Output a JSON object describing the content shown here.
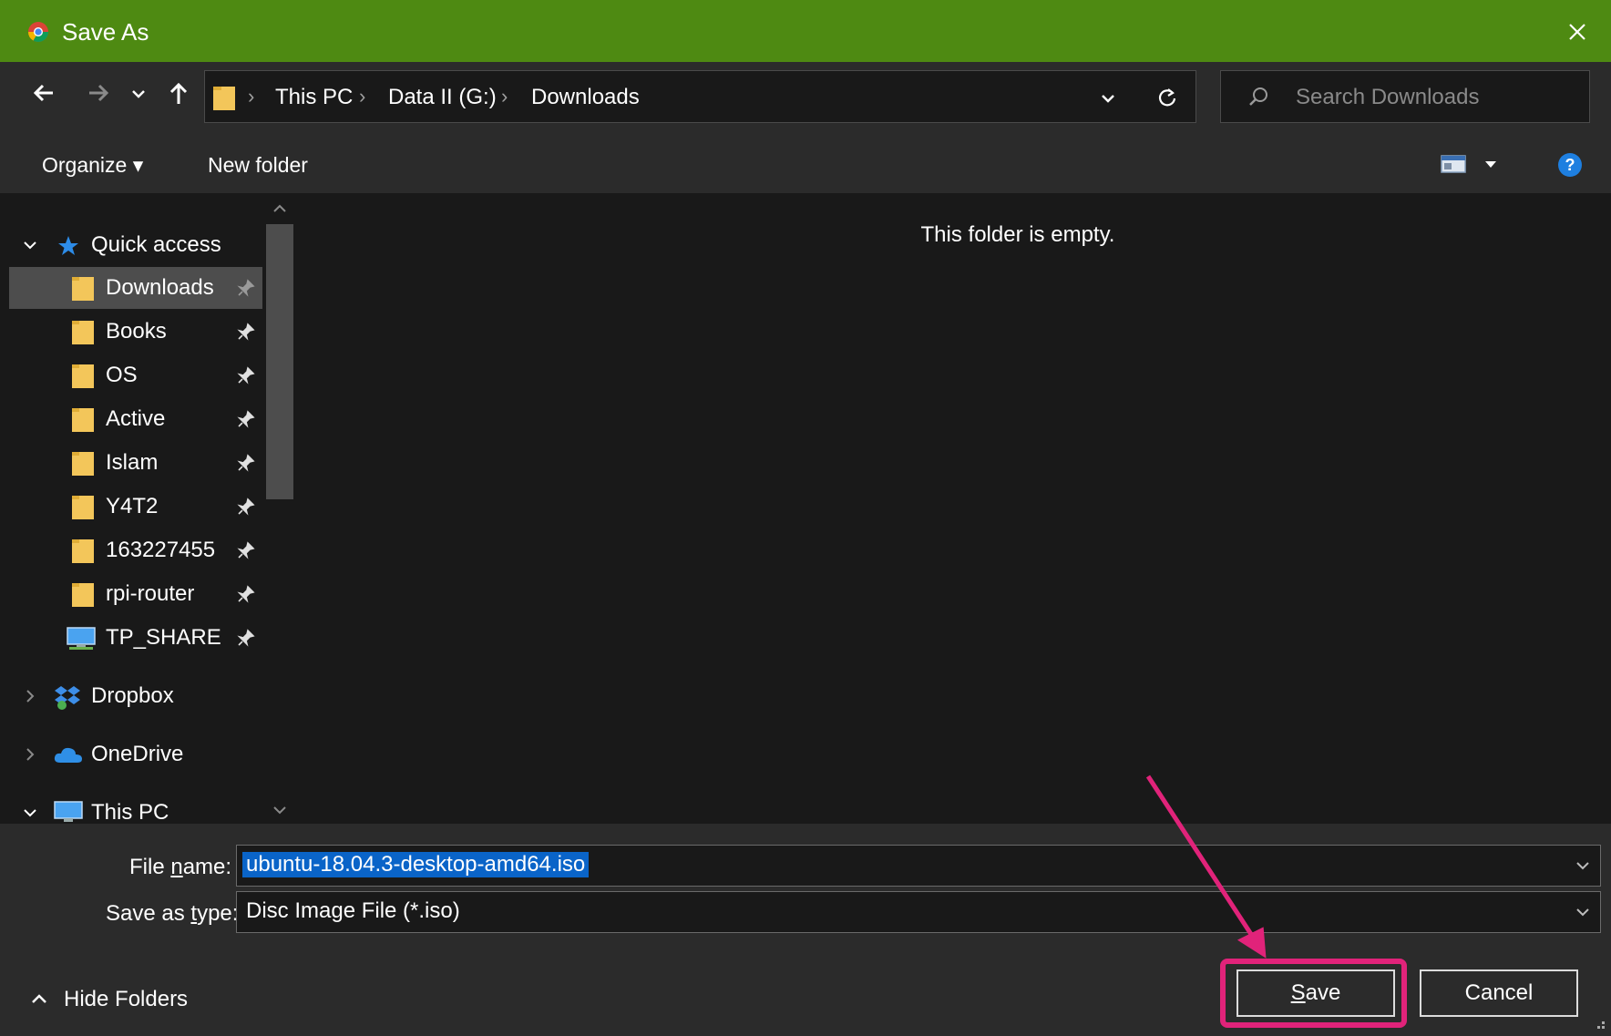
{
  "window": {
    "title": "Save As",
    "icon": "chrome-icon",
    "close_icon": "close-icon"
  },
  "nav": {
    "back_icon": "arrow-left-icon",
    "forward_icon": "arrow-right-icon",
    "recent_icon": "chevron-down-icon",
    "up_icon": "arrow-up-icon",
    "breadcrumbs": [
      "This PC",
      "Data II (G:)",
      "Downloads"
    ],
    "separator": "›",
    "refresh_icon": "refresh-icon",
    "search_placeholder": "Search Downloads"
  },
  "toolbar": {
    "organize_label": "Organize ▾",
    "new_folder_label": "New folder",
    "view_icon": "view-icon",
    "help_icon": "help-icon"
  },
  "sidebar": {
    "quick_access_label": "Quick access",
    "items": [
      {
        "label": "Downloads",
        "icon": "folder-icon",
        "pinned": true,
        "selected": true
      },
      {
        "label": "Books",
        "icon": "folder-icon",
        "pinned": true
      },
      {
        "label": "OS",
        "icon": "folder-icon",
        "pinned": true
      },
      {
        "label": "Active",
        "icon": "folder-icon",
        "pinned": true
      },
      {
        "label": "Islam",
        "icon": "folder-icon",
        "pinned": true
      },
      {
        "label": "Y4T2",
        "icon": "folder-icon",
        "pinned": true
      },
      {
        "label": "163227455",
        "icon": "folder-icon",
        "pinned": true
      },
      {
        "label": "rpi-router",
        "icon": "folder-icon",
        "pinned": true
      },
      {
        "label": "TP_SHARE",
        "icon": "network-drive-icon",
        "pinned": true
      }
    ],
    "dropbox_label": "Dropbox",
    "onedrive_label": "OneDrive",
    "this_pc_label": "This PC"
  },
  "content": {
    "empty_message": "This folder is empty."
  },
  "form": {
    "file_name_label_pre": "File ",
    "file_name_label_u": "n",
    "file_name_label_post": "ame:",
    "file_name_value": "ubuntu-18.04.3-desktop-amd64.iso",
    "save_type_label_pre": "Save as ",
    "save_type_label_u": "t",
    "save_type_label_post": "ype:",
    "save_type_value": "Disc Image File (*.iso)"
  },
  "footer": {
    "hide_folders_label": "Hide Folders",
    "save_label_u": "S",
    "save_label_rest": "ave",
    "cancel_label": "Cancel"
  },
  "colors": {
    "titlebar": "#4e8a12",
    "background": "#191919",
    "panel": "#2b2b2b",
    "selection": "#0a64c8",
    "annotation": "#e1237a"
  }
}
